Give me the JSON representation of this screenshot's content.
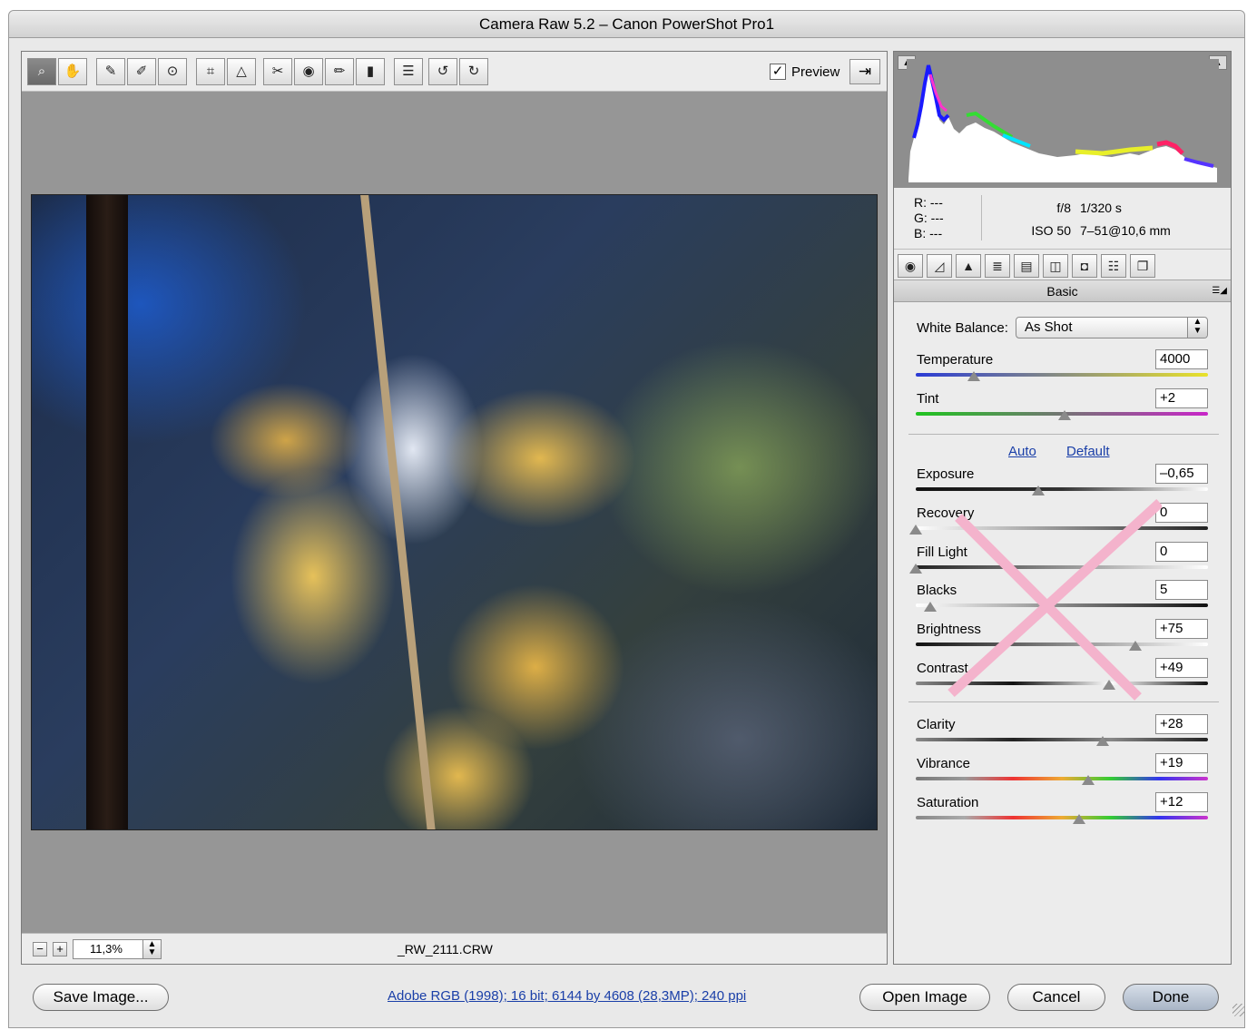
{
  "window": {
    "title": "Camera Raw 5.2  –  Canon PowerShot Pro1"
  },
  "toolbar": {
    "tools": [
      {
        "name": "zoom-tool-icon",
        "glyph": "🔍"
      },
      {
        "name": "hand-tool-icon",
        "glyph": "✋"
      },
      {
        "name": "white-balance-tool-icon",
        "glyph": "✎"
      },
      {
        "name": "color-sampler-tool-icon",
        "glyph": "✐"
      },
      {
        "name": "targeted-adjustment-tool-icon",
        "glyph": "⊙"
      },
      {
        "name": "crop-tool-icon",
        "glyph": "⌗"
      },
      {
        "name": "straighten-tool-icon",
        "glyph": "△"
      },
      {
        "name": "spot-removal-tool-icon",
        "glyph": "✂"
      },
      {
        "name": "red-eye-removal-tool-icon",
        "glyph": "◉"
      },
      {
        "name": "adjustment-brush-icon",
        "glyph": "✏"
      },
      {
        "name": "graduated-filter-icon",
        "glyph": "▮"
      },
      {
        "name": "preferences-icon",
        "glyph": "☰"
      },
      {
        "name": "rotate-left-icon",
        "glyph": "↺"
      },
      {
        "name": "rotate-right-icon",
        "glyph": "↻"
      }
    ],
    "preview_label": "Preview",
    "preview_checked": "✓"
  },
  "canvas": {
    "filename": "_RW_2111.CRW",
    "zoom": "11,3%"
  },
  "info": {
    "r_label": "R:",
    "r_value": "---",
    "g_label": "G:",
    "g_value": "---",
    "b_label": "B:",
    "b_value": "---",
    "aperture": "f/8",
    "shutter": "1/320 s",
    "iso": "ISO 50",
    "lens": "7–51@10,6 mm"
  },
  "panel": {
    "section_title": "Basic",
    "white_balance_label": "White Balance:",
    "white_balance_value": "As Shot",
    "auto_label": "Auto",
    "default_label": "Default",
    "sliders": {
      "temperature": {
        "label": "Temperature",
        "value": "4000",
        "fraction": 0.2
      },
      "tint": {
        "label": "Tint",
        "value": "+2",
        "fraction": 0.51
      },
      "exposure": {
        "label": "Exposure",
        "value": "–0,65",
        "fraction": 0.42
      },
      "recovery": {
        "label": "Recovery",
        "value": "0",
        "fraction": 0.0
      },
      "fill_light": {
        "label": "Fill Light",
        "value": "0",
        "fraction": 0.0
      },
      "blacks": {
        "label": "Blacks",
        "value": "5",
        "fraction": 0.05
      },
      "brightness": {
        "label": "Brightness",
        "value": "+75",
        "fraction": 0.75
      },
      "contrast": {
        "label": "Contrast",
        "value": "+49",
        "fraction": 0.66
      },
      "clarity": {
        "label": "Clarity",
        "value": "+28",
        "fraction": 0.64
      },
      "vibrance": {
        "label": "Vibrance",
        "value": "+19",
        "fraction": 0.59
      },
      "saturation": {
        "label": "Saturation",
        "value": "+12",
        "fraction": 0.56
      }
    }
  },
  "footer": {
    "save_label": "Save Image...",
    "workflow_options": "Adobe RGB (1998); 16 bit; 6144 by 4608 (28,3MP); 240 ppi",
    "open_label": "Open Image",
    "cancel_label": "Cancel",
    "done_label": "Done"
  },
  "colors": {
    "link": "#1a3fa8",
    "overlay_x": "#f4b3cc",
    "thumb": "#8a8a8a"
  }
}
